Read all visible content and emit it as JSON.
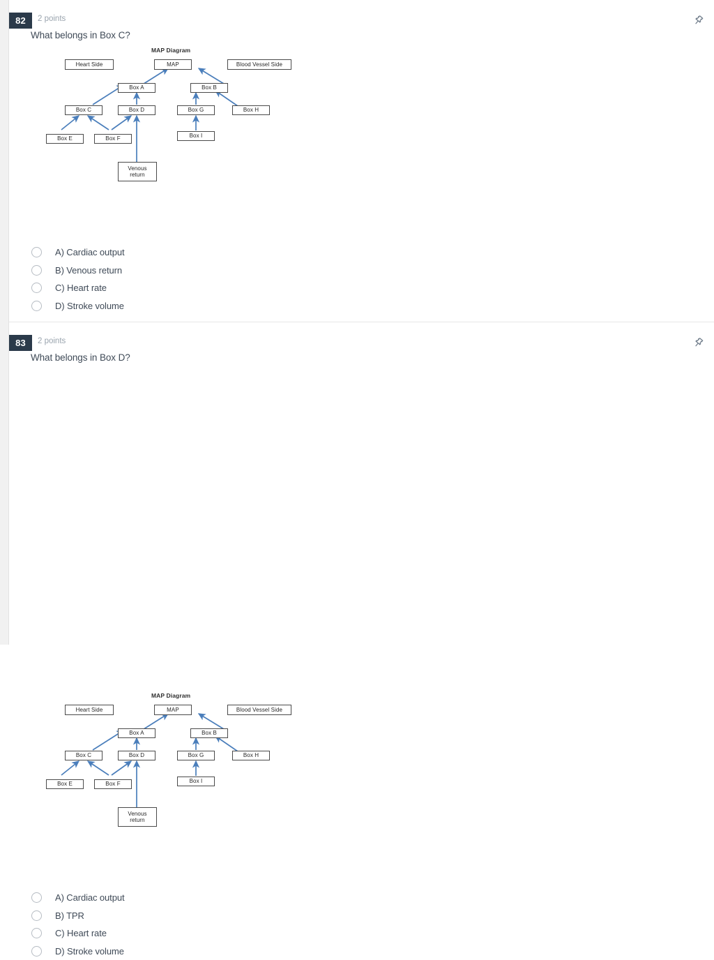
{
  "page": {
    "background": "#ffffff",
    "accent_badge_color": "#2b3a4a",
    "arrow_color": "#4a7ebb",
    "box_border_color": "#4a4a4a",
    "muted_text_color": "#9aa4ae"
  },
  "icons": {
    "pin": "pin-icon"
  },
  "questions": [
    {
      "number": "82",
      "points": "2 points",
      "title": "What belongs in Box C?",
      "diagram": {
        "title": "MAP Diagram",
        "boxes": [
          {
            "id": "heart-side",
            "label": "Heart Side"
          },
          {
            "id": "map",
            "label": "MAP"
          },
          {
            "id": "blood-vessel-side",
            "label": "Blood Vessel Side"
          },
          {
            "id": "box-a",
            "label": "Box A"
          },
          {
            "id": "box-b",
            "label": "Box B"
          },
          {
            "id": "box-c",
            "label": "Box C"
          },
          {
            "id": "box-d",
            "label": "Box D"
          },
          {
            "id": "box-g",
            "label": "Box G"
          },
          {
            "id": "box-h",
            "label": "Box H"
          },
          {
            "id": "box-e",
            "label": "Box E"
          },
          {
            "id": "box-f",
            "label": "Box F"
          },
          {
            "id": "box-i",
            "label": "Box I"
          },
          {
            "id": "venous-return",
            "label": "Venous\nreturn"
          }
        ],
        "arrows": [
          {
            "from": "box-a",
            "to": "map"
          },
          {
            "from": "box-b",
            "to": "map"
          },
          {
            "from": "box-c",
            "to": "box-a"
          },
          {
            "from": "box-d",
            "to": "box-a"
          },
          {
            "from": "box-e",
            "to": "box-c"
          },
          {
            "from": "box-f",
            "to": "box-c"
          },
          {
            "from": "box-f",
            "to": "box-d"
          },
          {
            "from": "venous-return",
            "to": "box-d"
          },
          {
            "from": "box-g",
            "to": "box-b"
          },
          {
            "from": "box-h",
            "to": "box-b"
          },
          {
            "from": "box-i",
            "to": "box-g"
          }
        ]
      },
      "options": [
        {
          "key": "A",
          "label": "A) Cardiac output",
          "selected": false
        },
        {
          "key": "B",
          "label": "B) Venous return",
          "selected": false
        },
        {
          "key": "C",
          "label": "C) Heart rate",
          "selected": false
        },
        {
          "key": "D",
          "label": "D) Stroke volume",
          "selected": false
        }
      ]
    },
    {
      "number": "83",
      "points": "2 points",
      "title": "What belongs in Box D?",
      "diagram": {
        "title": "MAP Diagram",
        "boxes": [
          {
            "id": "heart-side",
            "label": "Heart Side"
          },
          {
            "id": "map",
            "label": "MAP"
          },
          {
            "id": "blood-vessel-side",
            "label": "Blood Vessel Side"
          },
          {
            "id": "box-a",
            "label": "Box A"
          },
          {
            "id": "box-b",
            "label": "Box B"
          },
          {
            "id": "box-c",
            "label": "Box C"
          },
          {
            "id": "box-d",
            "label": "Box D"
          },
          {
            "id": "box-g",
            "label": "Box G"
          },
          {
            "id": "box-h",
            "label": "Box H"
          },
          {
            "id": "box-e",
            "label": "Box E"
          },
          {
            "id": "box-f",
            "label": "Box F"
          },
          {
            "id": "box-i",
            "label": "Box I"
          },
          {
            "id": "venous-return",
            "label": "Venous\nreturn"
          }
        ],
        "arrows": [
          {
            "from": "box-a",
            "to": "map"
          },
          {
            "from": "box-b",
            "to": "map"
          },
          {
            "from": "box-c",
            "to": "box-a"
          },
          {
            "from": "box-d",
            "to": "box-a"
          },
          {
            "from": "box-e",
            "to": "box-c"
          },
          {
            "from": "box-f",
            "to": "box-c"
          },
          {
            "from": "box-f",
            "to": "box-d"
          },
          {
            "from": "venous-return",
            "to": "box-d"
          },
          {
            "from": "box-g",
            "to": "box-b"
          },
          {
            "from": "box-h",
            "to": "box-b"
          },
          {
            "from": "box-i",
            "to": "box-g"
          }
        ]
      },
      "options": [
        {
          "key": "A",
          "label": "A) Cardiac output",
          "selected": false
        },
        {
          "key": "B",
          "label": "B) TPR",
          "selected": false
        },
        {
          "key": "C",
          "label": "C) Heart rate",
          "selected": false
        },
        {
          "key": "D",
          "label": "D) Stroke volume",
          "selected": false
        }
      ]
    }
  ]
}
